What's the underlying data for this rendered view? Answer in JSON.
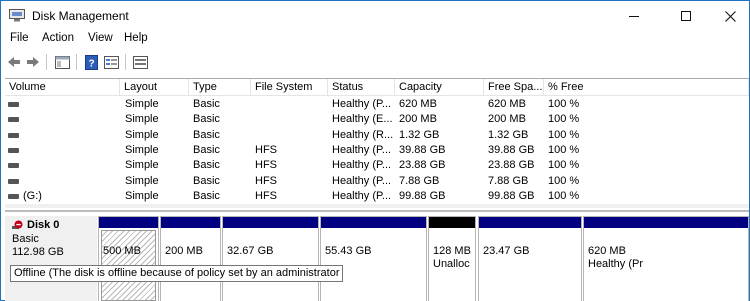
{
  "window": {
    "title": "Disk Management"
  },
  "menu": [
    "File",
    "Action",
    "View",
    "Help"
  ],
  "toolbar": {
    "icons": [
      "back-arrow-icon",
      "forward-arrow-icon",
      "console-tree-icon",
      "help-icon",
      "properties-icon",
      "disk-list-icon"
    ]
  },
  "volumes": {
    "columns": [
      "Volume",
      "Layout",
      "Type",
      "File System",
      "Status",
      "Capacity",
      "Free Spa...",
      "% Free"
    ],
    "rows": [
      [
        "",
        "Simple",
        "Basic",
        "",
        "Healthy (P...",
        "620 MB",
        "620 MB",
        "100 %"
      ],
      [
        "",
        "Simple",
        "Basic",
        "",
        "Healthy (E...",
        "200 MB",
        "200 MB",
        "100 %"
      ],
      [
        "",
        "Simple",
        "Basic",
        "",
        "Healthy (R...",
        "1.32 GB",
        "1.32 GB",
        "100 %"
      ],
      [
        "",
        "Simple",
        "Basic",
        "HFS",
        "Healthy (P...",
        "39.88 GB",
        "39.88 GB",
        "100 %"
      ],
      [
        "",
        "Simple",
        "Basic",
        "HFS",
        "Healthy (P...",
        "23.88 GB",
        "23.88 GB",
        "100 %"
      ],
      [
        "",
        "Simple",
        "Basic",
        "HFS",
        "Healthy (P...",
        "7.88 GB",
        "7.88 GB",
        "100 %"
      ],
      [
        "(G:)",
        "Simple",
        "Basic",
        "HFS",
        "Healthy (P...",
        "99.88 GB",
        "99.88 GB",
        "100 %"
      ]
    ]
  },
  "disk": {
    "name": "Disk 0",
    "type": "Basic",
    "size": "112.98 GB",
    "partitions": [
      {
        "line1": "500 MB",
        "line2": "",
        "style": "hatched"
      },
      {
        "line1": "200 MB",
        "line2": "",
        "style": "primary"
      },
      {
        "line1": "32.67 GB",
        "line2": "",
        "style": "primary"
      },
      {
        "line1": "55.43 GB",
        "line2": "",
        "style": "primary"
      },
      {
        "line1": "128 MB",
        "line2": "Unalloc",
        "style": "unallocated"
      },
      {
        "line1": "23.47 GB",
        "line2": "",
        "style": "primary"
      },
      {
        "line1": "620 MB",
        "line2": "Healthy (Pr",
        "style": "primary"
      }
    ],
    "tooltip": "Offline (The disk is offline because of policy set by an administrator"
  },
  "colors": {
    "primary_bar": "#000080",
    "unallocated_bar": "#000000",
    "offline_icon": "#c0001a"
  }
}
